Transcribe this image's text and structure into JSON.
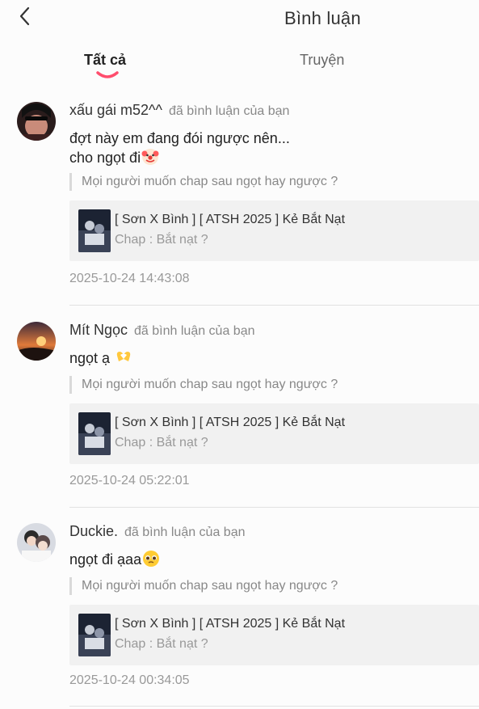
{
  "header": {
    "title": "Bình luận",
    "back_icon": "chevron-left-icon"
  },
  "tabs": [
    {
      "label": "Tất cả",
      "active": true
    },
    {
      "label": "Truyện",
      "active": false
    }
  ],
  "colors": {
    "accent": "#ff4d6d",
    "card_bg": "#f1f1f1",
    "muted": "#999999"
  },
  "notifications": [
    {
      "username": "xấu gái m52^^",
      "action": "đã bình luận của bạn",
      "message": "đợt này em đang đói ngược nên...\ncho ngọt đi",
      "emoji": "clown-face-emoji",
      "quote": "Mọi người muốn chap sau ngọt hay ngược ?",
      "story": {
        "title": "[ Sơn X Bình ] [ ATSH 2025 ] Kẻ Bắt Nạt",
        "chapter": "Chap : Bắt nạt ?"
      },
      "timestamp": "2025-10-24 14:43:08"
    },
    {
      "username": "Mít Ngọc",
      "action": "đã bình luận của bạn",
      "message": "ngọt ạ",
      "emoji": "heart-hands-emoji",
      "quote": "Mọi người muốn chap sau ngọt hay ngược ?",
      "story": {
        "title": "[ Sơn X Bình ] [ ATSH 2025 ] Kẻ Bắt Nạt",
        "chapter": "Chap : Bắt nạt ?"
      },
      "timestamp": "2025-10-24 05:22:01"
    },
    {
      "username": "Duckie.",
      "action": "đã bình luận của bạn",
      "message": "ngọt đi ạaa",
      "emoji": "pleading-face-emoji",
      "quote": "Mọi người muốn chap sau ngọt hay ngược ?",
      "story": {
        "title": "[ Sơn X Bình ] [ ATSH 2025 ] Kẻ Bắt Nạt",
        "chapter": "Chap : Bắt nạt ?"
      },
      "timestamp": "2025-10-24 00:34:05"
    }
  ]
}
